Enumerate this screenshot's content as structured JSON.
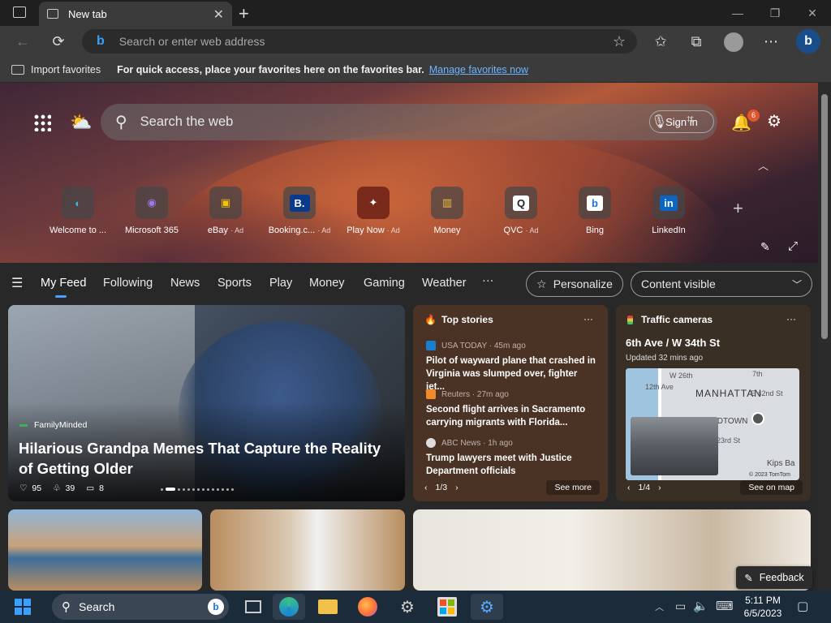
{
  "browser": {
    "tab_title": "New tab",
    "address_placeholder": "Search or enter web address"
  },
  "favorites_bar": {
    "import_label": "Import favorites",
    "message": "For quick access, place your favorites here on the favorites bar.",
    "manage_link": "Manage favorites now"
  },
  "hero": {
    "search_placeholder": "Search the web",
    "signin_label": "Sign in",
    "notification_count": "6",
    "tiles": [
      {
        "label": "Welcome to ...",
        "ad": ""
      },
      {
        "label": "Microsoft 365",
        "ad": ""
      },
      {
        "label": "eBay",
        "ad": "· Ad"
      },
      {
        "label": "Booking.c...",
        "ad": "· Ad"
      },
      {
        "label": "Play Now",
        "ad": "· Ad"
      },
      {
        "label": "Money",
        "ad": ""
      },
      {
        "label": "QVC",
        "ad": "· Ad"
      },
      {
        "label": "Bing",
        "ad": ""
      },
      {
        "label": "LinkedIn",
        "ad": ""
      }
    ]
  },
  "feed_nav": {
    "items": [
      "My Feed",
      "Following",
      "News",
      "Sports",
      "Play",
      "Money",
      "Gaming",
      "Weather"
    ],
    "more": "···",
    "personalize": "Personalize",
    "content_visible": "Content visible"
  },
  "main_card": {
    "source": "FamilyMinded",
    "headline": "Hilarious Grandpa Memes That Capture the Reality of Getting Older",
    "likes": "95",
    "dislikes": "39",
    "comments": "8"
  },
  "top_stories": {
    "title": "Top stories",
    "stories": [
      {
        "source": "USA TODAY · 45m ago",
        "headline": "Pilot of wayward plane that crashed in Virginia was slumped over, fighter jet..."
      },
      {
        "source": "Reuters · 27m ago",
        "headline": "Second flight arrives in Sacramento carrying migrants with Florida..."
      },
      {
        "source": "ABC News · 1h ago",
        "headline": "Trump lawyers meet with Justice Department officials"
      }
    ],
    "pager": "1/3",
    "see_more": "See more"
  },
  "traffic": {
    "title": "Traffic cameras",
    "location": "6th Ave / W 34th St",
    "updated": "Updated 32 mins ago",
    "map_labels": [
      "MANHATTAN",
      "7th",
      "E 42nd St",
      "12th Ave",
      "W 26th",
      "IDTOWN",
      "Kips Ba",
      "23rd St"
    ],
    "copyright": "© 2023 TomTom",
    "pager": "1/4",
    "see_on_map": "See on map"
  },
  "feedback": "Feedback",
  "taskbar": {
    "search": "Search",
    "time": "5:11 PM",
    "date": "6/5/2023"
  }
}
